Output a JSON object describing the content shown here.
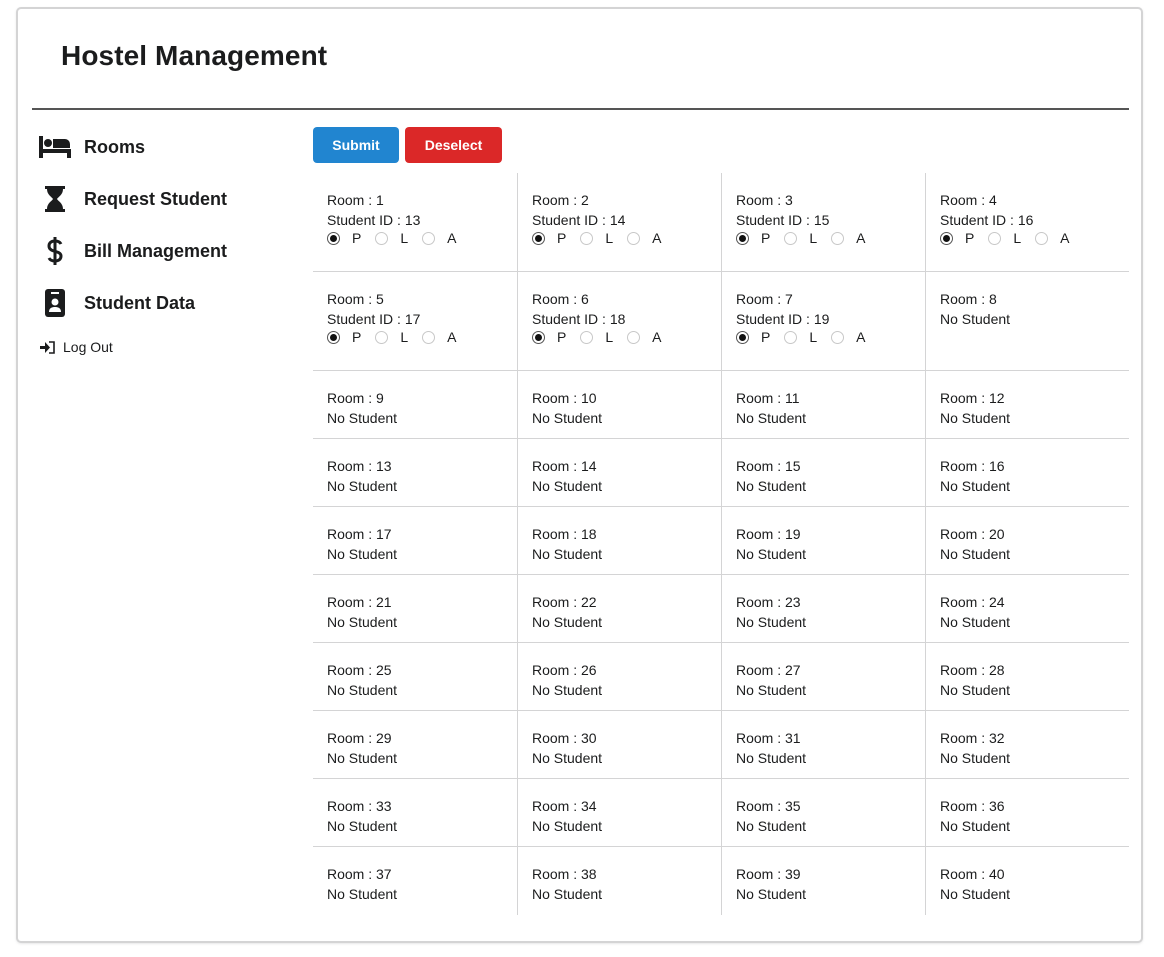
{
  "app": {
    "title": "Hostel Management"
  },
  "sidebar": {
    "items": [
      {
        "label": "Rooms",
        "icon": "bed-icon"
      },
      {
        "label": "Request Student",
        "icon": "hourglass-icon"
      },
      {
        "label": "Bill Management",
        "icon": "dollar-icon"
      },
      {
        "label": "Student Data",
        "icon": "id-badge-icon"
      }
    ],
    "logout": {
      "label": "Log Out",
      "icon": "sign-in-icon"
    }
  },
  "toolbar": {
    "submit_label": "Submit",
    "deselect_label": "Deselect"
  },
  "colors": {
    "submit": "#2185d0",
    "deselect": "#db2828"
  },
  "attendance_options": [
    "P",
    "L",
    "A"
  ],
  "rooms": [
    {
      "room": "Room : 1",
      "student": "Student ID : 13",
      "selected": "P"
    },
    {
      "room": "Room : 2",
      "student": "Student ID : 14",
      "selected": "P"
    },
    {
      "room": "Room : 3",
      "student": "Student ID : 15",
      "selected": "P"
    },
    {
      "room": "Room : 4",
      "student": "Student ID : 16",
      "selected": "P"
    },
    {
      "room": "Room : 5",
      "student": "Student ID : 17",
      "selected": "P"
    },
    {
      "room": "Room : 6",
      "student": "Student ID : 18",
      "selected": "P"
    },
    {
      "room": "Room : 7",
      "student": "Student ID : 19",
      "selected": "P"
    },
    {
      "room": "Room : 8",
      "student": "No Student"
    },
    {
      "room": "Room : 9",
      "student": "No Student"
    },
    {
      "room": "Room : 10",
      "student": "No Student"
    },
    {
      "room": "Room : 11",
      "student": "No Student"
    },
    {
      "room": "Room : 12",
      "student": "No Student"
    },
    {
      "room": "Room : 13",
      "student": "No Student"
    },
    {
      "room": "Room : 14",
      "student": "No Student"
    },
    {
      "room": "Room : 15",
      "student": "No Student"
    },
    {
      "room": "Room : 16",
      "student": "No Student"
    },
    {
      "room": "Room : 17",
      "student": "No Student"
    },
    {
      "room": "Room : 18",
      "student": "No Student"
    },
    {
      "room": "Room : 19",
      "student": "No Student"
    },
    {
      "room": "Room : 20",
      "student": "No Student"
    },
    {
      "room": "Room : 21",
      "student": "No Student"
    },
    {
      "room": "Room : 22",
      "student": "No Student"
    },
    {
      "room": "Room : 23",
      "student": "No Student"
    },
    {
      "room": "Room : 24",
      "student": "No Student"
    },
    {
      "room": "Room : 25",
      "student": "No Student"
    },
    {
      "room": "Room : 26",
      "student": "No Student"
    },
    {
      "room": "Room : 27",
      "student": "No Student"
    },
    {
      "room": "Room : 28",
      "student": "No Student"
    },
    {
      "room": "Room : 29",
      "student": "No Student"
    },
    {
      "room": "Room : 30",
      "student": "No Student"
    },
    {
      "room": "Room : 31",
      "student": "No Student"
    },
    {
      "room": "Room : 32",
      "student": "No Student"
    },
    {
      "room": "Room : 33",
      "student": "No Student"
    },
    {
      "room": "Room : 34",
      "student": "No Student"
    },
    {
      "room": "Room : 35",
      "student": "No Student"
    },
    {
      "room": "Room : 36",
      "student": "No Student"
    },
    {
      "room": "Room : 37",
      "student": "No Student"
    },
    {
      "room": "Room : 38",
      "student": "No Student"
    },
    {
      "room": "Room : 39",
      "student": "No Student"
    },
    {
      "room": "Room : 40",
      "student": "No Student"
    }
  ]
}
